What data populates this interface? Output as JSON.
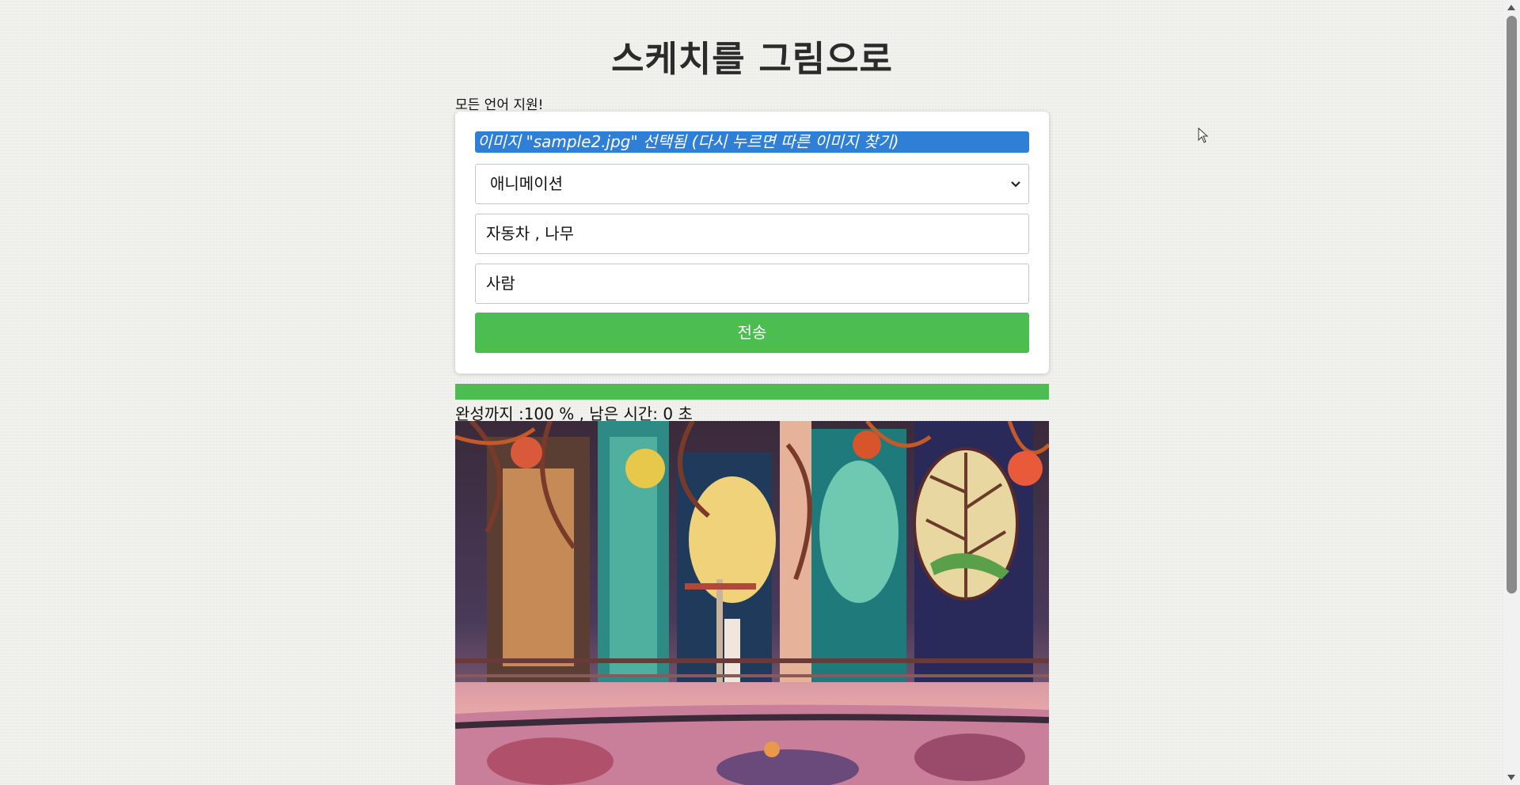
{
  "page": {
    "title": "스케치를 그림으로",
    "subtitle": "모든 언어 지원!"
  },
  "form": {
    "file_label": "이미지 \"sample2.jpg\" 선택됨 (다시 누르면 따른 이미지 찾기)",
    "style_selected": "애니메이션",
    "prompt_value": "자동차 , 나무",
    "negative_value": "사람",
    "submit_label": "전송"
  },
  "progress": {
    "percent": 100,
    "status_text": "완성까지 :100 % , 남은 시간: 0 초"
  },
  "colors": {
    "accent_green": "#4bbd51",
    "file_highlight": "#2f7fd6"
  },
  "icons": {
    "select_chevron": "chevron-down-icon",
    "mouse_pointer": "cursor-icon"
  }
}
